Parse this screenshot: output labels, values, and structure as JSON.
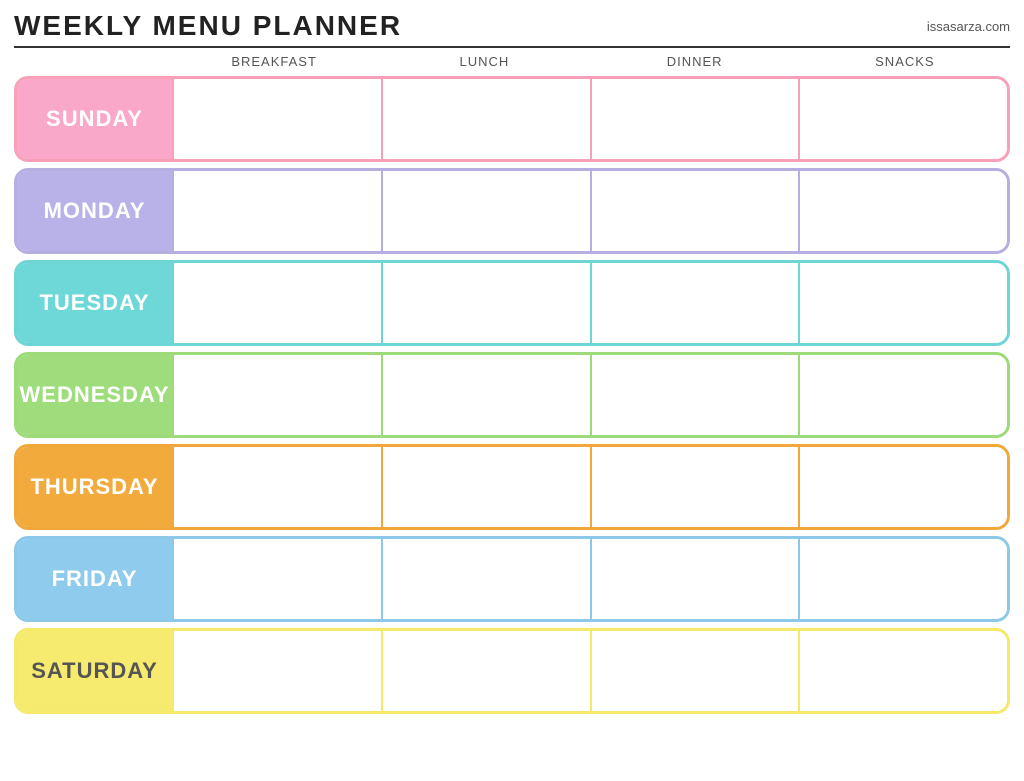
{
  "header": {
    "title": "Weekly Menu Planner",
    "website": "issasarza.com"
  },
  "columns": {
    "day_placeholder": "",
    "breakfast": "Breakfast",
    "lunch": "Lunch",
    "dinner": "Dinner",
    "snacks": "Snacks"
  },
  "days": [
    {
      "id": "sunday",
      "label": "Sunday",
      "color_class": "row-sunday"
    },
    {
      "id": "monday",
      "label": "Monday",
      "color_class": "row-monday"
    },
    {
      "id": "tuesday",
      "label": "Tuesday",
      "color_class": "row-tuesday"
    },
    {
      "id": "wednesday",
      "label": "Wednesday",
      "color_class": "row-wednesday"
    },
    {
      "id": "thursday",
      "label": "Thursday",
      "color_class": "row-thursday"
    },
    {
      "id": "friday",
      "label": "Friday",
      "color_class": "row-friday"
    },
    {
      "id": "saturday",
      "label": "Saturday",
      "color_class": "row-saturday"
    }
  ]
}
